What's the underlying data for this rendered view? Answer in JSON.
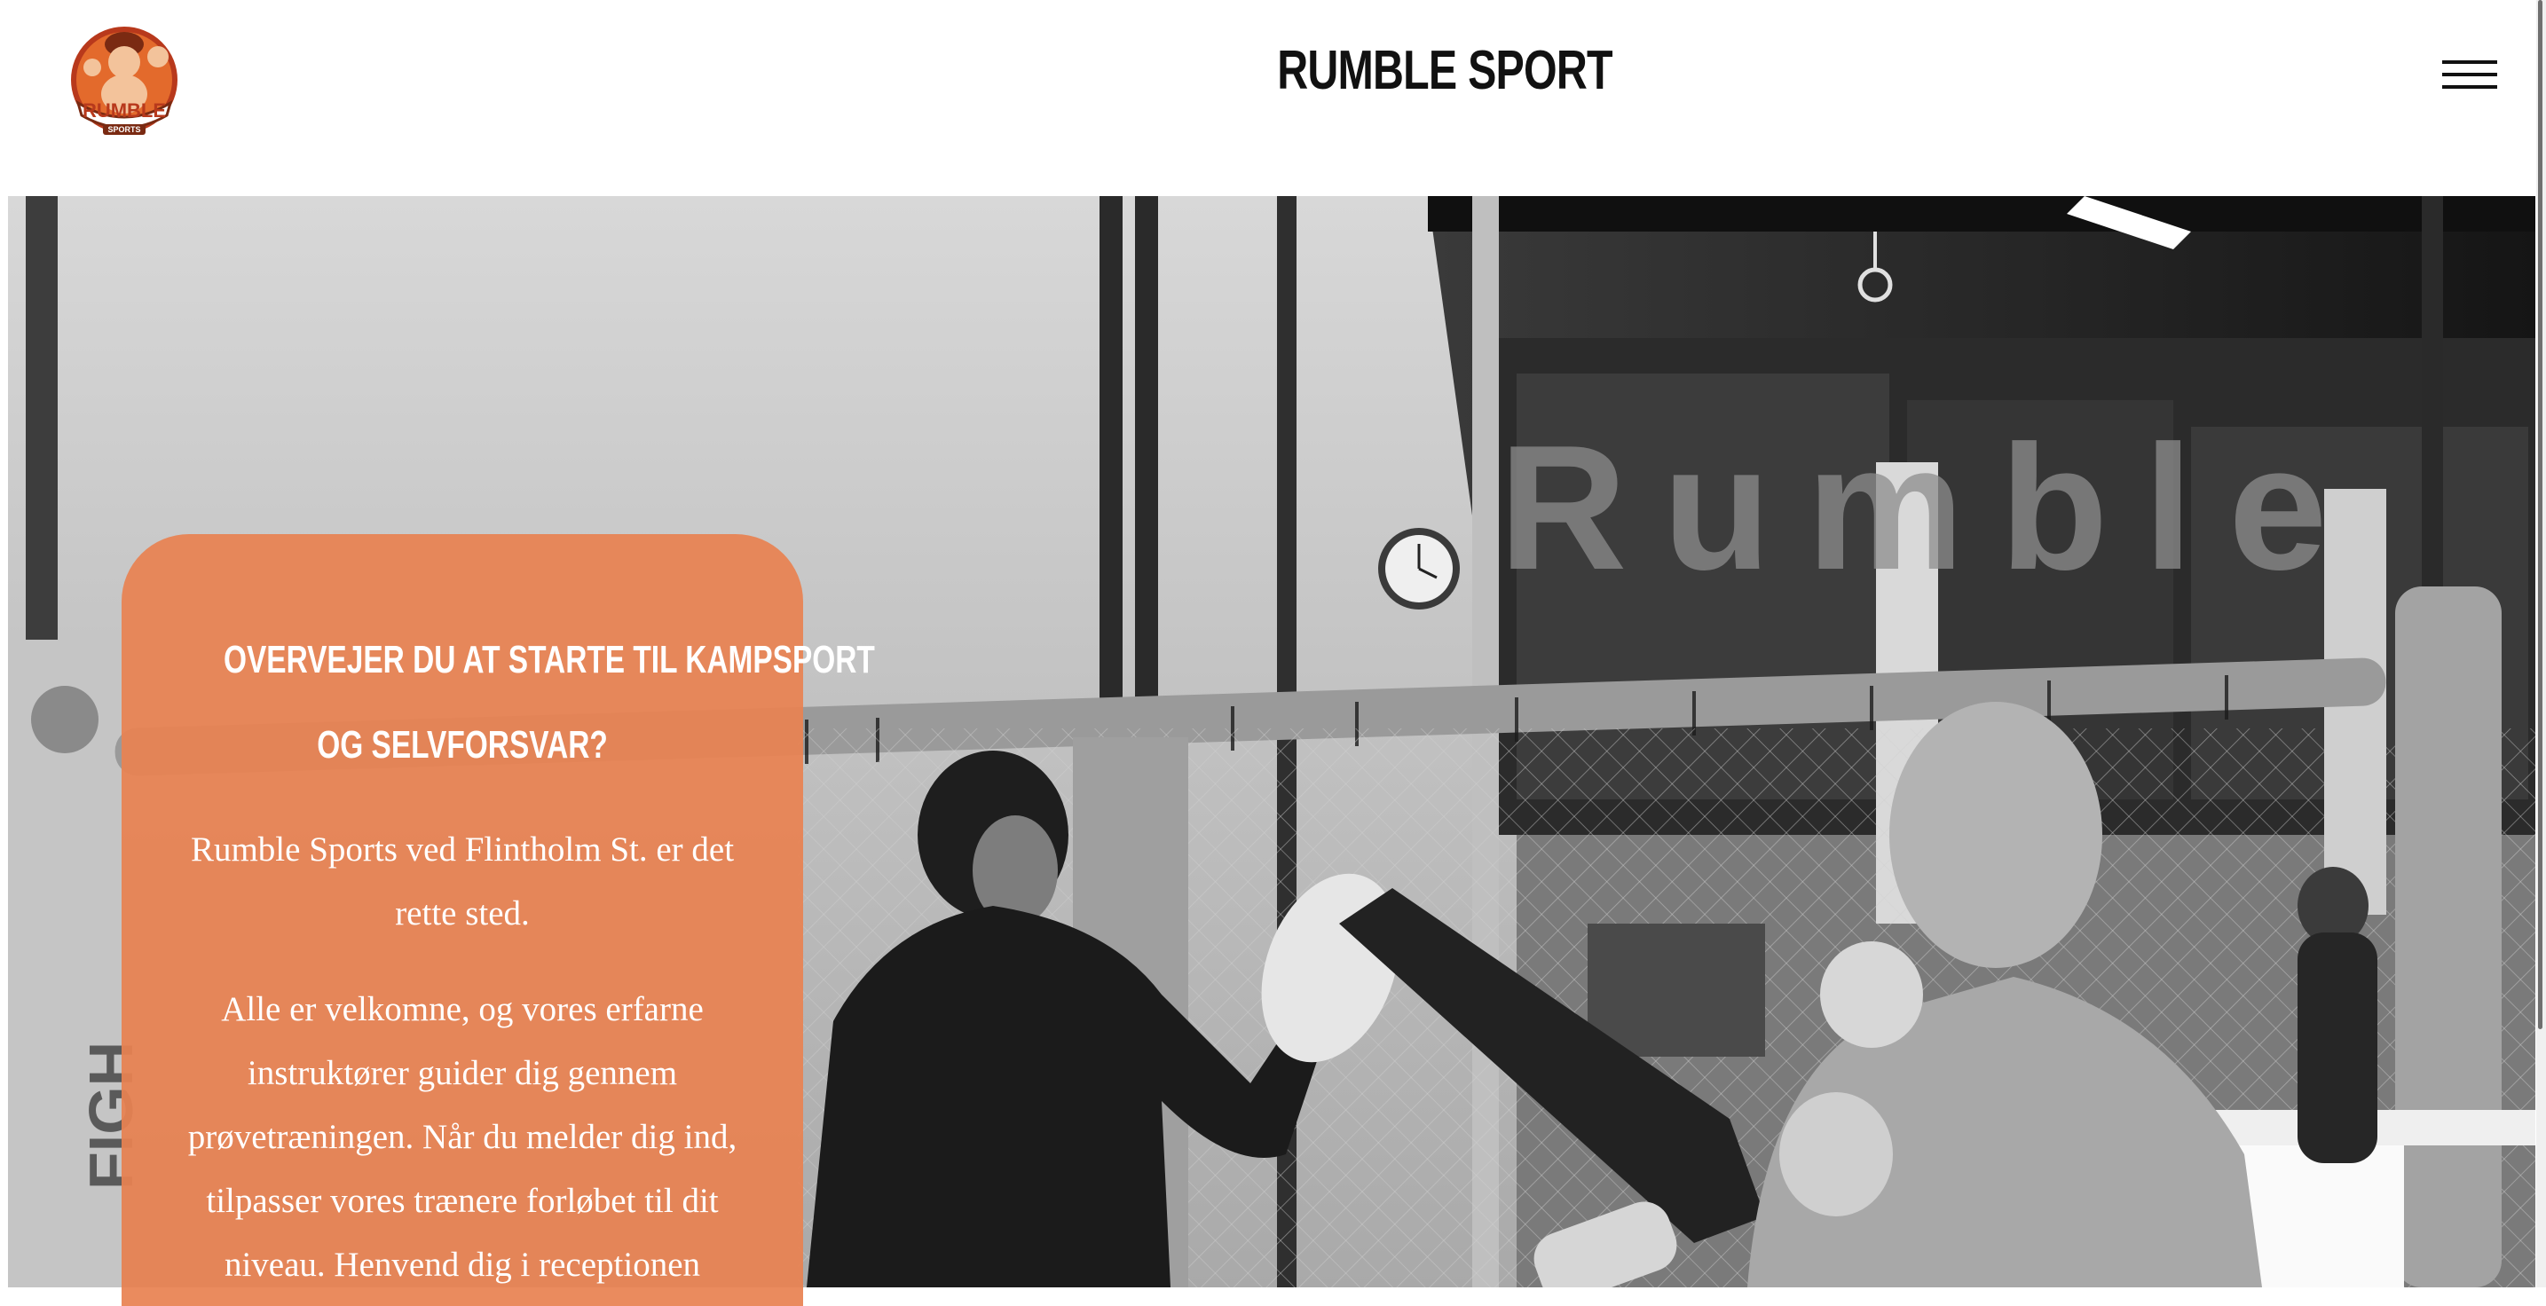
{
  "header": {
    "logo_text": "RUMBLE",
    "logo_subtext": "SPORTS",
    "title": "RUMBLE SPORT"
  },
  "promo": {
    "heading_line1": "OVERVEJER DU AT STARTE TIL KAMPSPORT",
    "heading_line2": "OG SELVFORSVAR?",
    "paragraph1": "Rumble Sports ved Flintholm St. er det rette sted.",
    "paragraph2": "Alle er velkomne, og vores erfarne instruktører guider dig gennem prøvetræningen. Når du melder dig ind, tilpasser vores trænere forløbet til dit niveau. Henvend dig i receptionen"
  },
  "hero": {
    "wall_lettering": "Rumble",
    "banner_lettering": "FIGH"
  },
  "colors": {
    "accent": "#e88252",
    "text_dark": "#111111",
    "background": "#ffffff"
  },
  "icons": {
    "menu": "hamburger-menu-icon"
  }
}
